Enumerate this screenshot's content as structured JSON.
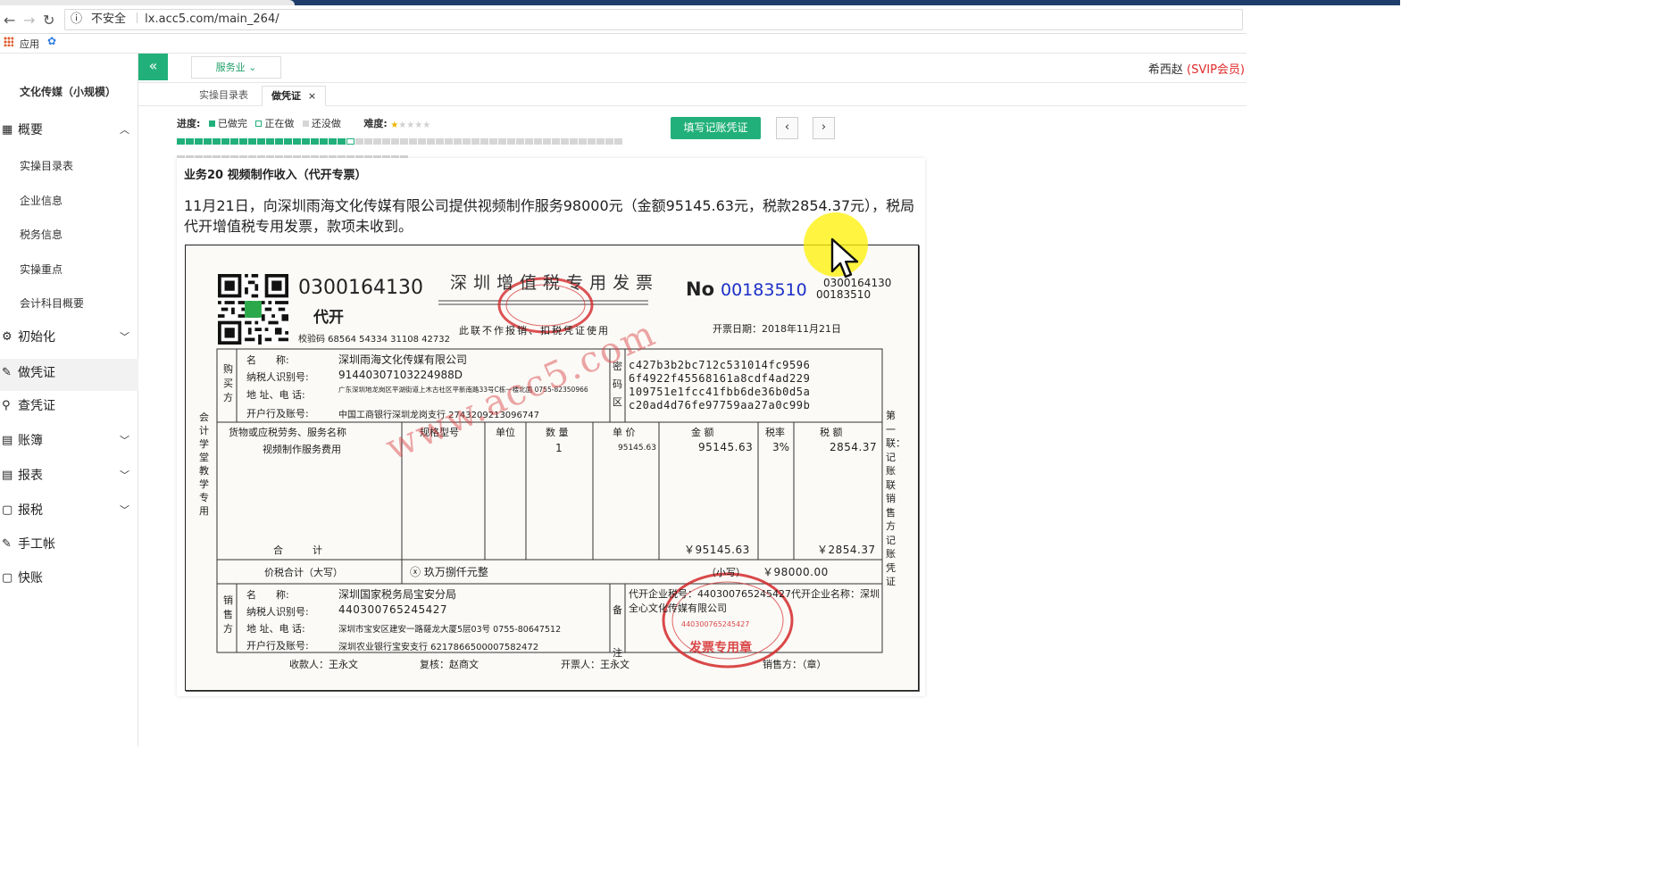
{
  "browser": {
    "security_label": "不安全",
    "url": "lx.acc5.com/main_264/",
    "bookmark_apps": "应用"
  },
  "sidebar": {
    "company": "文化传媒（小规模）",
    "groups": [
      {
        "label": "概要",
        "icon": "grid-icon",
        "expanded": true
      },
      {
        "label": "初始化",
        "icon": "gear-icon",
        "expanded": false
      },
      {
        "label": "做凭证",
        "icon": "pencil-icon",
        "active": true
      },
      {
        "label": "查凭证",
        "icon": "search-icon"
      },
      {
        "label": "账簿",
        "icon": "book-icon",
        "expanded": false
      },
      {
        "label": "报表",
        "icon": "list-icon",
        "expanded": false
      },
      {
        "label": "报税",
        "icon": "document-icon",
        "expanded": false
      },
      {
        "label": "手工帐",
        "icon": "pencil-icon"
      },
      {
        "label": "快账",
        "icon": "document-icon"
      }
    ],
    "sub_items": [
      "实操目录表",
      "企业信息",
      "税务信息",
      "实操重点",
      "会计科目概要"
    ]
  },
  "header": {
    "collapse_glyph": "«",
    "industry": "服务业",
    "user_name": "希西赵",
    "user_level": "(SVIP会员)"
  },
  "tabs": [
    {
      "label": "实操目录表",
      "active": false
    },
    {
      "label": "做凭证",
      "active": true,
      "close": "×"
    }
  ],
  "progress": {
    "label": "进度:",
    "legend_done": "已做完",
    "legend_doing": "正在做",
    "legend_todo": "还没做",
    "difficulty_label": "难度:",
    "difficulty_stars": 1,
    "difficulty_max": 5,
    "segments_done": 19,
    "segments_current": 1,
    "segments_total": 76,
    "colors": {
      "done": "#22b07a",
      "todo": "#d6d6d6"
    }
  },
  "toolbar": {
    "fill_voucher": "填写记账凭证",
    "prev": "‹",
    "next": "›"
  },
  "task": {
    "title": "业务20 视频制作收入（代开专票）",
    "description": "11月21日，向深圳雨海文化传媒有限公司提供视频制作服务98000元（金额95145.63元，税款2854.37元），税局代开增值税专用发票，款项未收到。"
  },
  "invoice": {
    "code": "0300164130",
    "daikai": "代开",
    "check_code": "校验码 68564 54334 31108 42732",
    "title": "深圳增值税专用发票",
    "subtitle": "此联不作报销、扣税凭证使用",
    "no_label": "No",
    "number": "00183510",
    "code_small": "0300164130",
    "number_small": "00183510",
    "issue_date": "开票日期：2018年11月21日",
    "left_side_label": "会计学堂教学专用",
    "right_side_label": "第一联：记账联 销售方记账凭证",
    "buyer": {
      "section": "购买方",
      "name_label": "名　　称:",
      "name": "深圳雨海文化传媒有限公司",
      "tax_id_label": "纳税人识别号:",
      "tax_id": "91440307103224988D",
      "address_label": "地 址、电 话:",
      "address": "广东深圳地龙岗区平湖街道上木古社区平新南路33号C栋一楼北面 0755-82350966",
      "bank_label": "开户行及账号:",
      "bank": "中国工商银行深圳龙岗支行 2743209213096747"
    },
    "cipher_label": "密码区",
    "cipher": [
      "c427b3b2bc712c531014fc9596",
      "6f4922f45568161a8cdf4ad229",
      "109751e1fcc41fbb6de36b0d5a",
      "c20ad4d76fe97759aa27a0c99b"
    ],
    "columns": [
      "货物或应税劳务、服务名称",
      "规格型号",
      "单位",
      "数 量",
      "单 价",
      "金 额",
      "税率",
      "税 额"
    ],
    "items": [
      {
        "name": "视频制作服务费用",
        "spec": "",
        "unit": "",
        "qty": "1",
        "price": "95145.63",
        "amount": "95145.63",
        "rate": "3%",
        "tax": "2854.37"
      }
    ],
    "total_label": "合　　　计",
    "total_amount": "￥95145.63",
    "total_tax": "￥2854.37",
    "grand_label": "价税合计（大写）",
    "grand_words": "ⓧ 玖万捌仟元整",
    "grand_small_label": "（小写）",
    "grand_small": "￥98000.00",
    "seller": {
      "section": "销售方",
      "name_label": "名　　称:",
      "name": "深圳国家税务局宝安分局",
      "tax_id_label": "纳税人识别号:",
      "tax_id": "440300765245427",
      "address_label": "地 址、电 话:",
      "address": "深圳市宝安区建安一路薩龙大厦5层03号 0755-80647512",
      "bank_label": "开户行及账号:",
      "bank": "深圳农业银行宝安支行 6217866500007582472"
    },
    "remark_label": "备注",
    "remark_text": "代开企业税号：440300765245427代开企业名称：深圳全心文化传媒有限公司",
    "payee": "收款人：王永文",
    "reviewer": "复核：赵商文",
    "drawer": "开票人：王永文",
    "seller_seal_label": "销售方：（章）",
    "watermark": "www.acc5.com",
    "seal_text": "发票专用章",
    "seal_tax_id": "440300765245427",
    "seal_colors": {
      "red": "#d4282a"
    }
  }
}
